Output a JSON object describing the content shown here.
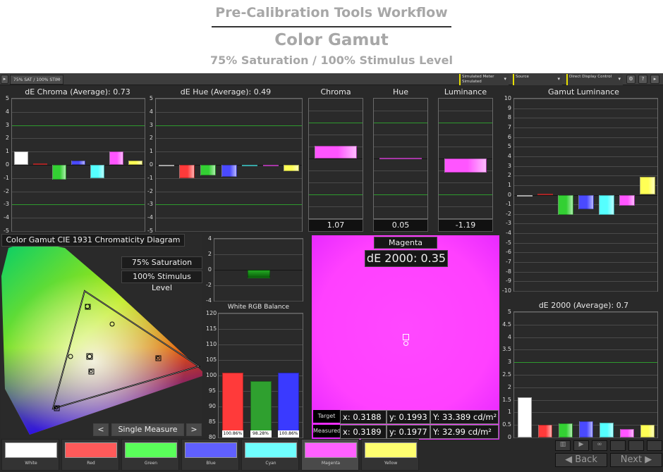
{
  "header": {
    "workflow_title": "Pre-Calibration Tools Workflow",
    "section_title": "Color Gamut",
    "subtitle": "75% Saturation / 100% Stimulus Level"
  },
  "toolbar": {
    "tab_label": "75% SAT / 100% STIM",
    "meter_line1": "Simulated Meter",
    "meter_line2": "Simulated",
    "source_label": "Source",
    "display_label": "Direct Display Control"
  },
  "charts": {
    "de_chroma_title": "dE Chroma (Average): 0.73",
    "de_hue_title": "dE Hue (Average): 0.49",
    "chroma_title": "Chroma",
    "hue_title": "Hue",
    "luminance_title": "Luminance",
    "gamut_lum_title": "Gamut Luminance",
    "de2000_title": "dE 2000 (Average): 0.7",
    "balance_title": "White RGB Balance",
    "chroma_value": "1.07",
    "hue_value": "0.05",
    "luminance_value": "-1.19"
  },
  "chart_data": [
    {
      "type": "bar",
      "title": "dE Chroma (Average): 0.73",
      "categories": [
        "White",
        "Red",
        "Green",
        "Blue",
        "Cyan",
        "Magenta",
        "Yellow"
      ],
      "values": [
        1.0,
        0.1,
        -1.1,
        0.3,
        -1.0,
        1.0,
        0.3
      ],
      "ylim": [
        -5,
        5
      ],
      "colors": [
        "#ffffff",
        "#ff3a3a",
        "#33d033",
        "#4a4aff",
        "#55ffff",
        "#ff55ff",
        "#ffff55"
      ]
    },
    {
      "type": "bar",
      "title": "dE Hue (Average): 0.49",
      "categories": [
        "White",
        "Red",
        "Green",
        "Blue",
        "Cyan",
        "Magenta",
        "Yellow"
      ],
      "values": [
        0,
        -1.0,
        -0.8,
        -0.9,
        0,
        0,
        -0.5
      ],
      "ylim": [
        -5,
        5
      ],
      "colors": [
        "#ffffff",
        "#ff3a3a",
        "#33d033",
        "#4a4aff",
        "#55ffff",
        "#ff55ff",
        "#ffff55"
      ]
    },
    {
      "type": "bar",
      "title": "Chroma",
      "categories": [
        "Magenta"
      ],
      "values": [
        1.07
      ],
      "ylim": [
        -5,
        5
      ],
      "colors": [
        "#ff55ff"
      ]
    },
    {
      "type": "bar",
      "title": "Hue",
      "categories": [
        "Magenta"
      ],
      "values": [
        0.05
      ],
      "ylim": [
        -5,
        5
      ],
      "colors": [
        "#ff55ff"
      ]
    },
    {
      "type": "bar",
      "title": "Luminance",
      "categories": [
        "Magenta"
      ],
      "values": [
        -1.19
      ],
      "ylim": [
        -5,
        5
      ],
      "colors": [
        "#ff55ff"
      ]
    },
    {
      "type": "bar",
      "title": "Gamut Luminance",
      "categories": [
        "White",
        "Red",
        "Green",
        "Blue",
        "Cyan",
        "Magenta",
        "Yellow"
      ],
      "values": [
        0,
        0.1,
        -2.1,
        -1.5,
        -2.1,
        -1.1,
        1.9
      ],
      "ylim": [
        -10,
        10
      ],
      "colors": [
        "#ffffff",
        "#ff3a3a",
        "#33d033",
        "#4a4aff",
        "#55ffff",
        "#ff55ff",
        "#ffff55"
      ]
    },
    {
      "type": "bar",
      "title": "dE 2000 (Average): 0.7",
      "categories": [
        "White",
        "Red",
        "Green",
        "Blue",
        "Cyan",
        "Magenta",
        "Yellow"
      ],
      "values": [
        1.6,
        0.5,
        0.55,
        0.65,
        0.6,
        0.35,
        0.5
      ],
      "ylim": [
        0,
        5
      ],
      "colors": [
        "#ffffff",
        "#ff3a3a",
        "#33d033",
        "#4a4aff",
        "#55ffff",
        "#ff55ff",
        "#ffff55"
      ]
    },
    {
      "type": "bar",
      "title": "",
      "categories": [
        "Magenta"
      ],
      "values": [
        -1.1
      ],
      "ylim": [
        -4,
        4
      ],
      "colors": [
        "#117711"
      ]
    },
    {
      "type": "bar",
      "title": "White RGB Balance",
      "categories": [
        "R",
        "G",
        "B"
      ],
      "values": [
        100.86,
        98.28,
        100.86
      ],
      "data_labels": [
        "100.86%",
        "98.28%",
        "100.86%"
      ],
      "ylim": [
        80,
        120
      ],
      "colors": [
        "#ff3a3a",
        "#2fa02f",
        "#3a3aff"
      ]
    }
  ],
  "ticks": {
    "small": [
      "5",
      "4",
      "3",
      "2",
      "1",
      "0",
      "-1",
      "-2",
      "-3",
      "-4",
      "-5"
    ],
    "gamut": [
      "10",
      "9",
      "8",
      "7",
      "6",
      "5",
      "4",
      "3",
      "2",
      "1",
      "0",
      "-1",
      "-2",
      "-3",
      "-4",
      "-5",
      "-6",
      "-7",
      "-8",
      "-9",
      "-10"
    ],
    "de2000": [
      "5",
      "4.5",
      "4",
      "3.5",
      "3",
      "2.5",
      "2",
      "1.5",
      "1",
      "0.5",
      "0"
    ],
    "mini": [
      "4",
      "2",
      "0",
      "-2",
      "-4"
    ],
    "balance": [
      "120",
      "115",
      "110",
      "105",
      "100",
      "95",
      "90",
      "85",
      "80"
    ]
  },
  "cie": {
    "title": "Color Gamut CIE 1931 Chromaticity Diagram",
    "saturation": "75% Saturation",
    "stimulus": "100% Stimulus Level",
    "prev": "<",
    "next": ">",
    "measure": "Single Measure"
  },
  "magenta": {
    "name": "Magenta",
    "de": "dE 2000: 0.35",
    "target_label": "Target",
    "measured_label": "Measured",
    "target": {
      "x": "x: 0.3188",
      "y": "y: 0.1993",
      "Y": "Y: 33.389 cd/m²"
    },
    "measured": {
      "x": "x: 0.3189",
      "y": "y: 0.1977",
      "Y": "Y: 32.99 cd/m²"
    },
    "color": "#ff40ff"
  },
  "swatches": [
    {
      "label": "White",
      "color": "#ffffff"
    },
    {
      "label": "Red",
      "color": "#ff5a5a"
    },
    {
      "label": "Green",
      "color": "#5aff5a"
    },
    {
      "label": "Blue",
      "color": "#6060ff"
    },
    {
      "label": "Cyan",
      "color": "#70ffff"
    },
    {
      "label": "Magenta",
      "color": "#ff60ff"
    },
    {
      "label": "Yellow",
      "color": "#ffff70"
    }
  ],
  "nav": {
    "back": "Back",
    "next": "Next"
  }
}
